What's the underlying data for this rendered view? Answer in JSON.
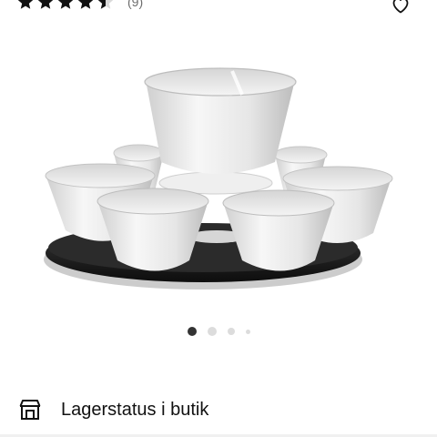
{
  "rating": {
    "stars_value": 4.5,
    "stars_max": 5,
    "count_label": "(9)"
  },
  "favorite": {
    "icon": "heart-outline-icon"
  },
  "product_image": {
    "alt": "Serving set with bowls on black tray"
  },
  "carousel": {
    "total": 4,
    "active_index": 0
  },
  "store_availability": {
    "icon": "store-icon",
    "label": "Lagerstatus i butik"
  }
}
